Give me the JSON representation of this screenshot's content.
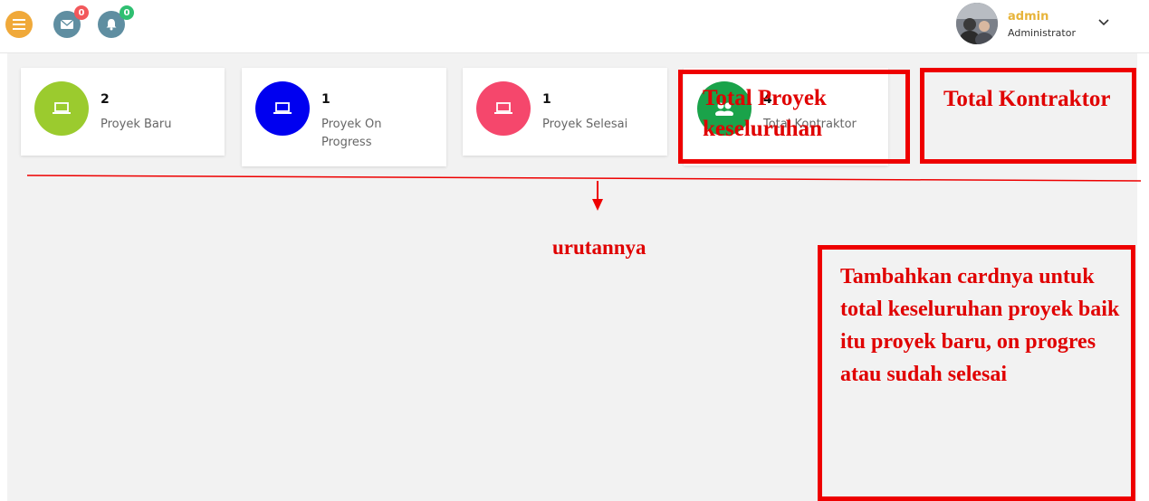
{
  "header": {
    "menu_icon": "hamburger-icon",
    "messages_badge": "0",
    "notifications_badge": "0",
    "user_name": "admin",
    "user_role": "Administrator"
  },
  "cards": [
    {
      "value": "2",
      "label": "Proyek Baru",
      "color": "#9bcb2e",
      "icon": "laptop-icon"
    },
    {
      "value": "1",
      "label": "Proyek On Progress",
      "color": "#0000f0",
      "icon": "laptop-icon"
    },
    {
      "value": "1",
      "label": "Proyek Selesai",
      "color": "#f5476c",
      "icon": "laptop-icon"
    },
    {
      "value": "4",
      "label": "Total Kontraktor",
      "color": "#1aa34a",
      "icon": "people-icon"
    }
  ],
  "annotations": {
    "box1": "Total Proyek keseluruhan",
    "box2": "Total Kontraktor",
    "arrow_label": "urutannya",
    "box3": "Tambahkan cardnya untuk total keseluruhan proyek baik itu proyek baru, on progres atau sudah selesai"
  },
  "colors": {
    "accent_orange": "#f0a93a",
    "icon_teal": "#5f8ea1",
    "badge_red": "#f2585b",
    "badge_green": "#2fbf71",
    "annotation_red": "#ee0000"
  }
}
